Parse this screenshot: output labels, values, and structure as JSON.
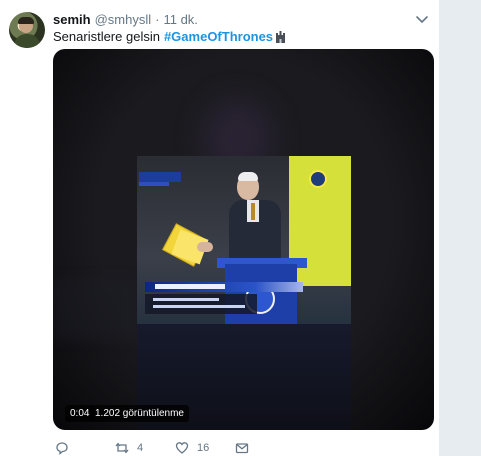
{
  "tweet": {
    "display_name": "semih",
    "handle": "@smhysll",
    "separator": "·",
    "time": "11 dk.",
    "text": "Senaristlere gelsin",
    "hashtag": "#GameOfThrones"
  },
  "video": {
    "timestamp": "0:04",
    "views": "1.202 görüntülenme"
  },
  "actions": {
    "reply_count": "",
    "retweet_count": "4",
    "like_count": "16"
  },
  "icons": {
    "caret": "chevron-down-icon",
    "reply": "reply-icon",
    "retweet": "retweet-icon",
    "like": "heart-icon",
    "message": "envelope-icon"
  },
  "colors": {
    "hashtag": "#1b95e0",
    "secondary_text": "#657786",
    "background": "#e6ecf0"
  }
}
